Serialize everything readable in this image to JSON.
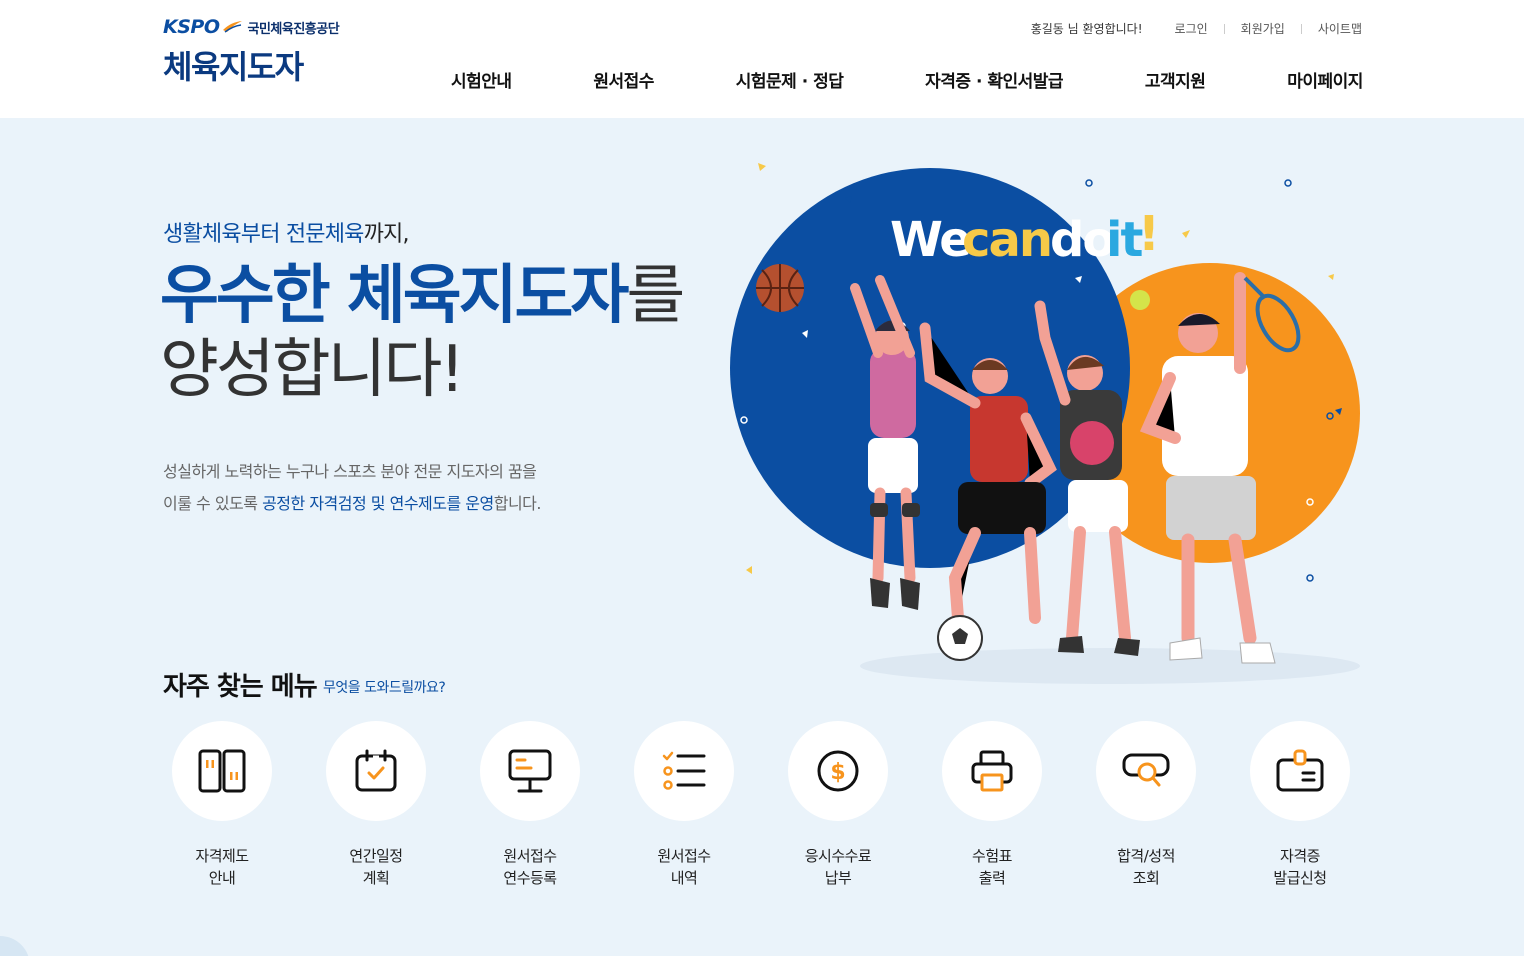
{
  "header": {
    "logo_brand": "KSPO",
    "logo_org": "국민체육진흥공단",
    "site_title": "체육지도자",
    "welcome": "홍길동 님 환영합니다!",
    "util_links": [
      "로그인",
      "회원가입",
      "사이트맵"
    ],
    "nav": [
      "시험안내",
      "원서접수",
      "시험문제 · 정답",
      "자격증 · 확인서발급",
      "고객지원",
      "마이페이지"
    ]
  },
  "hero": {
    "sub_part1": "생활체육부터 전문체육",
    "sub_part2": "까지,",
    "title_strong": "우수한 체육지도자",
    "title_particle": "를",
    "title_line2": "양성합니다!",
    "desc_line1": "성실하게 노력하는 누구나 스포츠 분야 전문 지도자의 꿈을",
    "desc_line2_a": "이룰 수 있도록 ",
    "desc_line2_hl": "공정한 자격검정 및 연수제도를 운영",
    "desc_line2_b": "합니다.",
    "illustration_text": "We can do it!"
  },
  "quick": {
    "title": "자주 찾는 메뉴",
    "subtitle": "무엇을 도와드릴까요?",
    "items": [
      {
        "line1": "자격제도",
        "line2": "안내",
        "icon": "document-panels-icon"
      },
      {
        "line1": "연간일정",
        "line2": "계획",
        "icon": "calendar-check-icon"
      },
      {
        "line1": "원서접수",
        "line2": "연수등록",
        "icon": "monitor-icon"
      },
      {
        "line1": "원서접수",
        "line2": "내역",
        "icon": "checklist-icon"
      },
      {
        "line1": "응시수수료",
        "line2": "납부",
        "icon": "dollar-coin-icon"
      },
      {
        "line1": "수험표",
        "line2": "출력",
        "icon": "printer-icon"
      },
      {
        "line1": "합격/성적",
        "line2": "조회",
        "icon": "search-result-icon"
      },
      {
        "line1": "자격증",
        "line2": "발급신청",
        "icon": "id-card-icon"
      }
    ]
  },
  "colors": {
    "brand_blue": "#0b4ea2",
    "accent_orange": "#f7941d",
    "bg_light": "#eaf3fa"
  }
}
